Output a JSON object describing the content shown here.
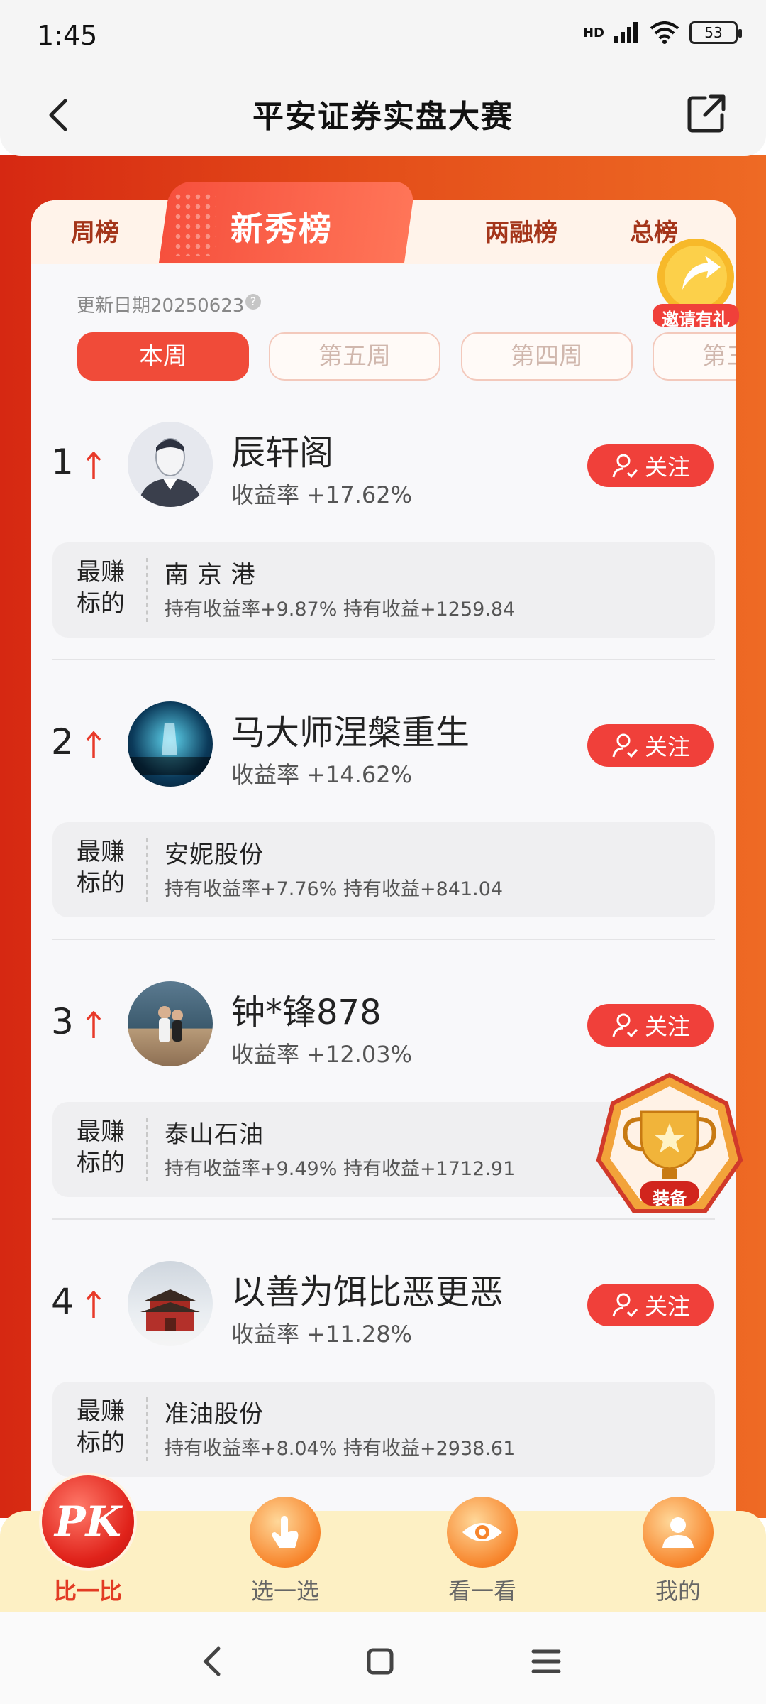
{
  "status_bar": {
    "time": "1:45",
    "network": "HD",
    "battery": "53"
  },
  "header": {
    "title": "平安证券实盘大赛"
  },
  "tabs": [
    {
      "label": "周榜",
      "active": false
    },
    {
      "label": "新秀榜",
      "active": true
    },
    {
      "label": "两融榜",
      "active": false
    },
    {
      "label": "总榜",
      "active": false
    }
  ],
  "update_date": "更新日期20250623",
  "weeks": [
    {
      "label": "本周",
      "active": true
    },
    {
      "label": "第五周",
      "active": false
    },
    {
      "label": "第四周",
      "active": false
    },
    {
      "label": "第三周",
      "active": false
    }
  ],
  "invite_badge": "邀请有礼",
  "trophy_badge": "装备",
  "follow_label": "关注",
  "best_label": "最赚标的",
  "rankings": [
    {
      "rank": "1",
      "name": "辰轩阁",
      "yield": "收益率 +17.62%",
      "stock": "南 京 港",
      "stats": "持有收益率+9.87% 持有收益+1259.84"
    },
    {
      "rank": "2",
      "name": "马大师涅槃重生",
      "yield": "收益率 +14.62%",
      "stock": "安妮股份",
      "stats": "持有收益率+7.76% 持有收益+841.04"
    },
    {
      "rank": "3",
      "name": "钟*锋878",
      "yield": "收益率 +12.03%",
      "stock": "泰山石油",
      "stats": "持有收益率+9.49% 持有收益+1712.91"
    },
    {
      "rank": "4",
      "name": "以善为饵比恶更恶",
      "yield": "收益率 +11.28%",
      "stock": "准油股份",
      "stats": "持有收益率+8.04% 持有收益+2938.61"
    }
  ],
  "bottom_nav": [
    {
      "label": "比一比",
      "active": true,
      "icon": "pk-icon"
    },
    {
      "label": "选一选",
      "active": false,
      "icon": "tap-icon"
    },
    {
      "label": "看一看",
      "active": false,
      "icon": "eye-icon"
    },
    {
      "label": "我的",
      "active": false,
      "icon": "user-icon"
    }
  ],
  "colors": {
    "accent": "#f0403a",
    "orange_bg": "#e44f1a",
    "up_arrow": "#e83a2a"
  }
}
